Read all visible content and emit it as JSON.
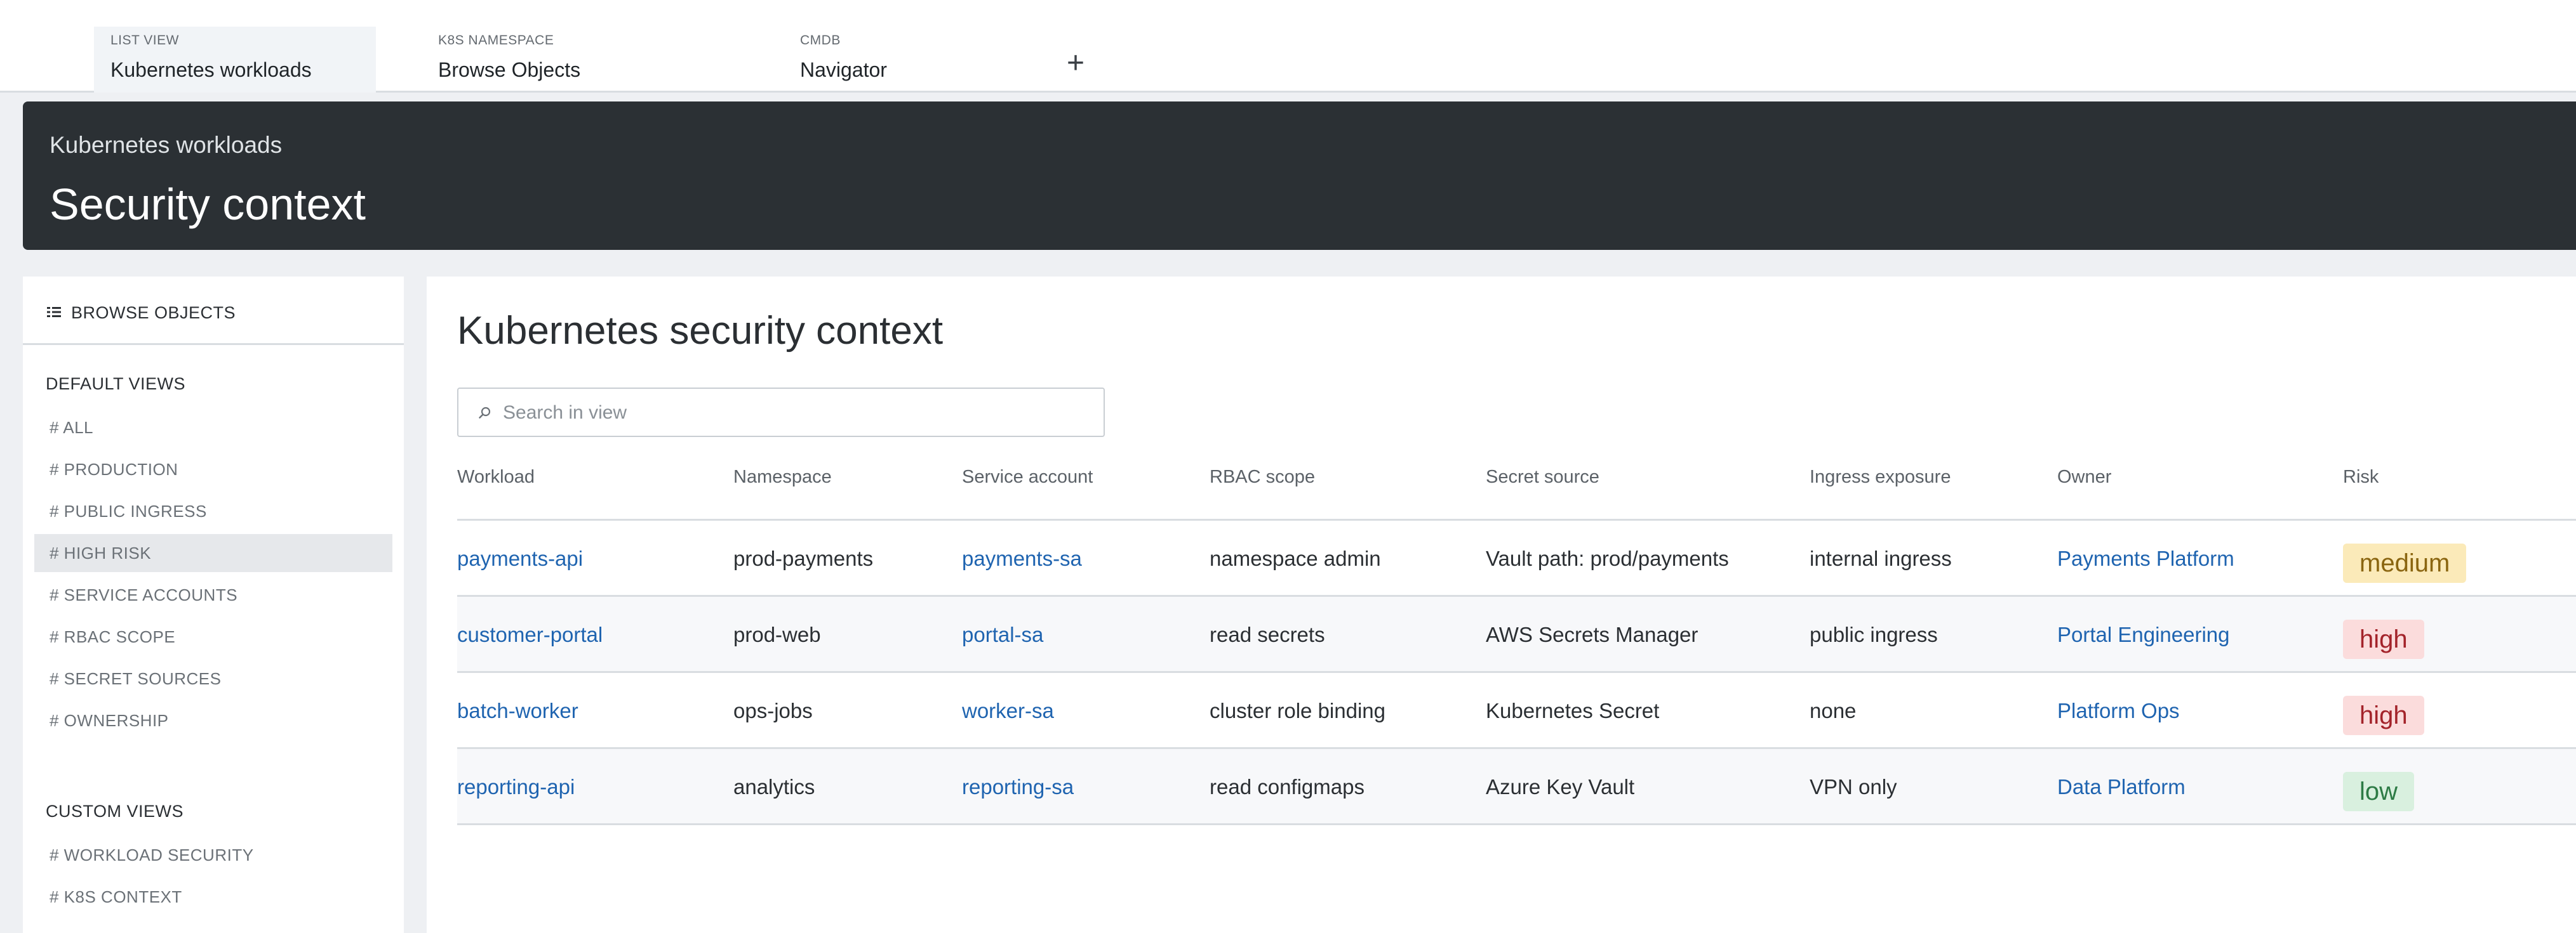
{
  "tabs": [
    {
      "kicker": "LIST VIEW",
      "title": "Kubernetes workloads",
      "active": true
    },
    {
      "kicker": "K8S NAMESPACE",
      "title": "Browse Objects",
      "active": false
    },
    {
      "kicker": "CMDB",
      "title": "Navigator",
      "active": false
    }
  ],
  "add_tab_label": "+",
  "header": {
    "breadcrumb": "Kubernetes workloads",
    "title": "Security context"
  },
  "sidebar": {
    "heading": "BROWSE OBJECTS",
    "default_views_title": "DEFAULT VIEWS",
    "default_views": [
      {
        "label": "# ALL"
      },
      {
        "label": "# PRODUCTION"
      },
      {
        "label": "# PUBLIC INGRESS"
      },
      {
        "label": "# HIGH RISK",
        "active": true
      },
      {
        "label": "# SERVICE ACCOUNTS"
      },
      {
        "label": "# RBAC SCOPE"
      },
      {
        "label": "# SECRET SOURCES"
      },
      {
        "label": "# OWNERSHIP"
      }
    ],
    "custom_views_title": "CUSTOM VIEWS",
    "custom_views": [
      {
        "label": "# WORKLOAD SECURITY"
      },
      {
        "label": "# K8S CONTEXT"
      }
    ]
  },
  "main": {
    "title": "Kubernetes security context",
    "search": {
      "placeholder": "Search in view",
      "value": ""
    },
    "columns": [
      "Workload",
      "Namespace",
      "Service account",
      "RBAC scope",
      "Secret source",
      "Ingress exposure",
      "Owner",
      "Risk"
    ],
    "rows": [
      {
        "workload": "payments-api",
        "namespace": "prod-payments",
        "service_account": "payments-sa",
        "rbac_scope": "namespace admin",
        "secret_source": "Vault path: prod/payments",
        "ingress": "internal ingress",
        "owner": "Payments Platform",
        "risk": "medium"
      },
      {
        "workload": "customer-portal",
        "namespace": "prod-web",
        "service_account": "portal-sa",
        "rbac_scope": "read secrets",
        "secret_source": "AWS Secrets Manager",
        "ingress": "public ingress",
        "owner": "Portal Engineering",
        "risk": "high"
      },
      {
        "workload": "batch-worker",
        "namespace": "ops-jobs",
        "service_account": "worker-sa",
        "rbac_scope": "cluster role binding",
        "secret_source": "Kubernetes Secret",
        "ingress": "none",
        "owner": "Platform Ops",
        "risk": "high"
      },
      {
        "workload": "reporting-api",
        "namespace": "analytics",
        "service_account": "reporting-sa",
        "rbac_scope": "read configmaps",
        "secret_source": "Azure Key Vault",
        "ingress": "VPN only",
        "owner": "Data Platform",
        "risk": "low"
      }
    ]
  },
  "colors": {
    "header_bg": "#2b3034",
    "link": "#1f64b0",
    "risk_medium": "#fbeab9",
    "risk_high": "#fbdcdc",
    "risk_low": "#d9f0df"
  }
}
